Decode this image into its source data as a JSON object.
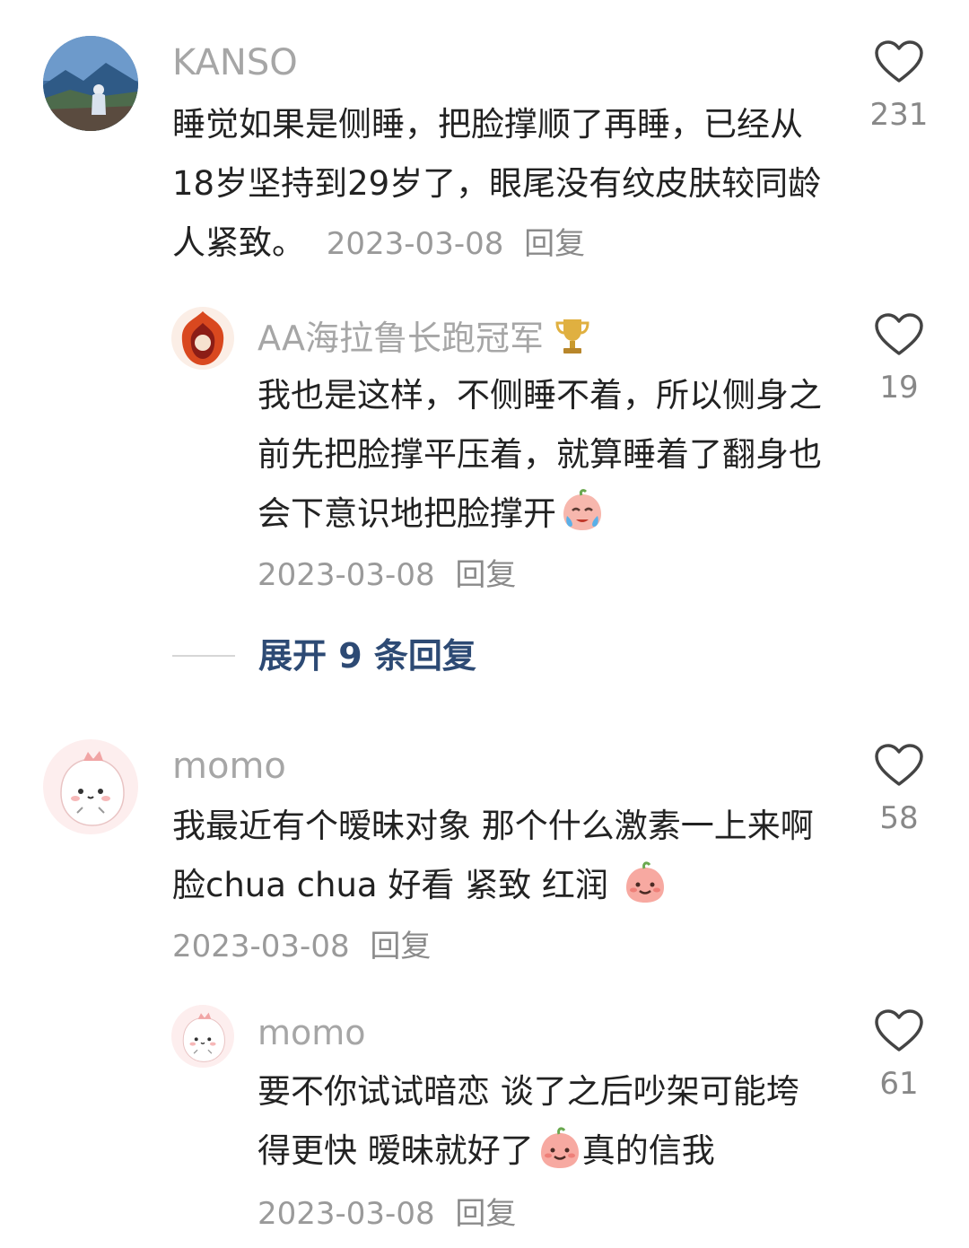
{
  "comments": [
    {
      "username": "KANSO",
      "text": "睡觉如果是侧睡，把脸撑顺了再睡，已经从18岁坚持到29岁了，眼尾没有纹皮肤较同龄人紧致。",
      "date": "2023-03-08",
      "reply_label": "回复",
      "likes": "231",
      "avatar_icon": "mountain-landscape-avatar"
    },
    {
      "username": "AA海拉鲁长跑冠军",
      "username_badge": "trophy-icon",
      "text": "我也是这样，不侧睡不着，所以侧身之前先把脸撑平压着，就算睡着了翻身也会下意识地把脸撑开",
      "emoji": "crying-emoji",
      "date": "2023-03-08",
      "reply_label": "回复",
      "likes": "19",
      "avatar_icon": "flame-avatar"
    },
    {
      "username": "momo",
      "text": "我最近有个暧昧对象 那个什么激素一上来啊 脸chua chua 好看 紧致 红润",
      "emoji": "peach-smile-emoji",
      "date": "2023-03-08",
      "reply_label": "回复",
      "likes": "58",
      "avatar_icon": "pink-cartoon-avatar"
    },
    {
      "username": "momo",
      "text_before_emoji": "要不你试试暗恋 谈了之后吵架可能垮得更快 暧昧就好了",
      "text_after_emoji": "真的信我",
      "emoji": "peach-smile-emoji",
      "date": "2023-03-08",
      "reply_label": "回复",
      "likes": "61",
      "avatar_icon": "pink-cartoon-avatar"
    }
  ],
  "expand_replies": {
    "label": "展开 9 条回复"
  },
  "colors": {
    "username": "#a6a6a6",
    "body_text": "#222222",
    "meta": "#9a9a9a",
    "expand_link": "#2d4a74",
    "heart_outline": "#444444"
  },
  "icons": {
    "like": "heart-outline-icon"
  }
}
